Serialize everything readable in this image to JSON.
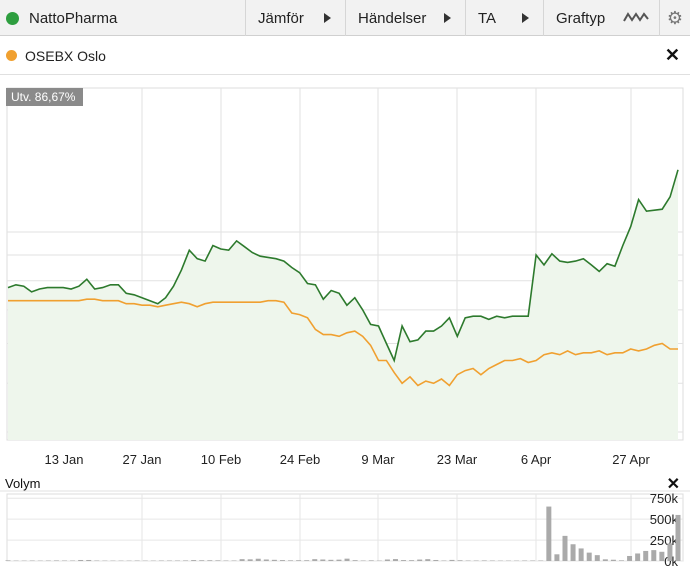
{
  "toolbar": {
    "instrument": "NattoPharma",
    "instrument_color": "#2e9e3f",
    "compare_label": "Jämför",
    "events_label": "Händelser",
    "ta_label": "TA",
    "graphtype_label": "Graftyp",
    "gear_icon": "gear-icon"
  },
  "compare": {
    "name": "OSEBX Oslo",
    "color": "#f0a030"
  },
  "chart_data": {
    "type": "line",
    "change_label": "Utv. 86,67%",
    "x_ticks": [
      "13 Jan",
      "27 Jan",
      "10 Feb",
      "24 Feb",
      "9 Mar",
      "23 Mar",
      "6 Apr",
      "27 Apr"
    ],
    "y_ticks": [
      "10",
      "9",
      "8",
      "7",
      "6",
      "5",
      "4"
    ],
    "y_scale": "log",
    "grid": true,
    "series": [
      {
        "name": "NattoPharma",
        "color": "#2d7a2d",
        "fill": "#eef6ec",
        "values": [
          7.75,
          7.85,
          7.8,
          7.6,
          7.7,
          7.75,
          7.75,
          7.75,
          7.7,
          7.8,
          8.05,
          7.7,
          7.75,
          7.85,
          7.85,
          7.55,
          7.5,
          7.4,
          7.3,
          7.2,
          7.4,
          7.8,
          8.4,
          9.2,
          8.85,
          8.75,
          9.4,
          9.25,
          9.2,
          9.6,
          9.35,
          9.1,
          8.95,
          8.9,
          8.85,
          8.75,
          8.5,
          8.3,
          7.9,
          7.85,
          7.35,
          7.65,
          7.55,
          7.15,
          7.4,
          7.0,
          6.55,
          6.5,
          6.0,
          5.55,
          6.5,
          6.05,
          6.1,
          6.35,
          6.35,
          6.5,
          6.75,
          6.2,
          6.75,
          6.8,
          6.8,
          6.7,
          6.8,
          6.75,
          6.8,
          6.8,
          6.8,
          9.0,
          8.6,
          9.05,
          8.75,
          8.7,
          8.75,
          8.85,
          8.6,
          8.35,
          8.65,
          8.55,
          9.4,
          10.25,
          11.6,
          11.0,
          11.05,
          11.1,
          11.75,
          13.3
        ]
      },
      {
        "name": "OSEBX Oslo",
        "color": "#f0a030",
        "values": [
          7.3,
          7.3,
          7.3,
          7.3,
          7.3,
          7.3,
          7.3,
          7.3,
          7.3,
          7.3,
          7.35,
          7.35,
          7.3,
          7.3,
          7.3,
          7.2,
          7.2,
          7.15,
          7.15,
          7.1,
          7.15,
          7.2,
          7.25,
          7.2,
          7.1,
          7.2,
          7.25,
          7.25,
          7.25,
          7.25,
          7.25,
          7.25,
          7.25,
          7.3,
          7.3,
          7.25,
          6.9,
          6.85,
          6.75,
          6.4,
          6.25,
          6.25,
          6.2,
          6.3,
          6.35,
          6.2,
          5.95,
          5.55,
          5.55,
          5.25,
          5.0,
          5.15,
          4.95,
          5.05,
          5.0,
          5.1,
          4.95,
          5.2,
          5.3,
          5.35,
          5.2,
          5.35,
          5.45,
          5.55,
          5.55,
          5.6,
          5.5,
          5.55,
          5.7,
          5.75,
          5.7,
          5.8,
          5.7,
          5.75,
          5.75,
          5.8,
          5.7,
          5.75,
          5.75,
          5.85,
          5.8,
          5.85,
          5.95,
          6.0,
          5.85,
          5.85
        ]
      }
    ],
    "volume": {
      "label": "Volym",
      "y_ticks": [
        "750k",
        "500k",
        "250k",
        "0k"
      ],
      "values": [
        8,
        5,
        5,
        6,
        5,
        6,
        7,
        6,
        6,
        12,
        12,
        6,
        5,
        5,
        5,
        5,
        6,
        5,
        5,
        6,
        6,
        6,
        7,
        11,
        9,
        9,
        8,
        6,
        6,
        22,
        20,
        27,
        18,
        14,
        11,
        8,
        9,
        9,
        22,
        18,
        14,
        16,
        28,
        10,
        6,
        8,
        5,
        18,
        23,
        11,
        10,
        17,
        22,
        12,
        6,
        13,
        9,
        6,
        6,
        7,
        6,
        5,
        5,
        5,
        6,
        6,
        6,
        650,
        80,
        300,
        200,
        150,
        100,
        70,
        20,
        15,
        8,
        60,
        90,
        120,
        130,
        110,
        210,
        550
      ]
    }
  }
}
